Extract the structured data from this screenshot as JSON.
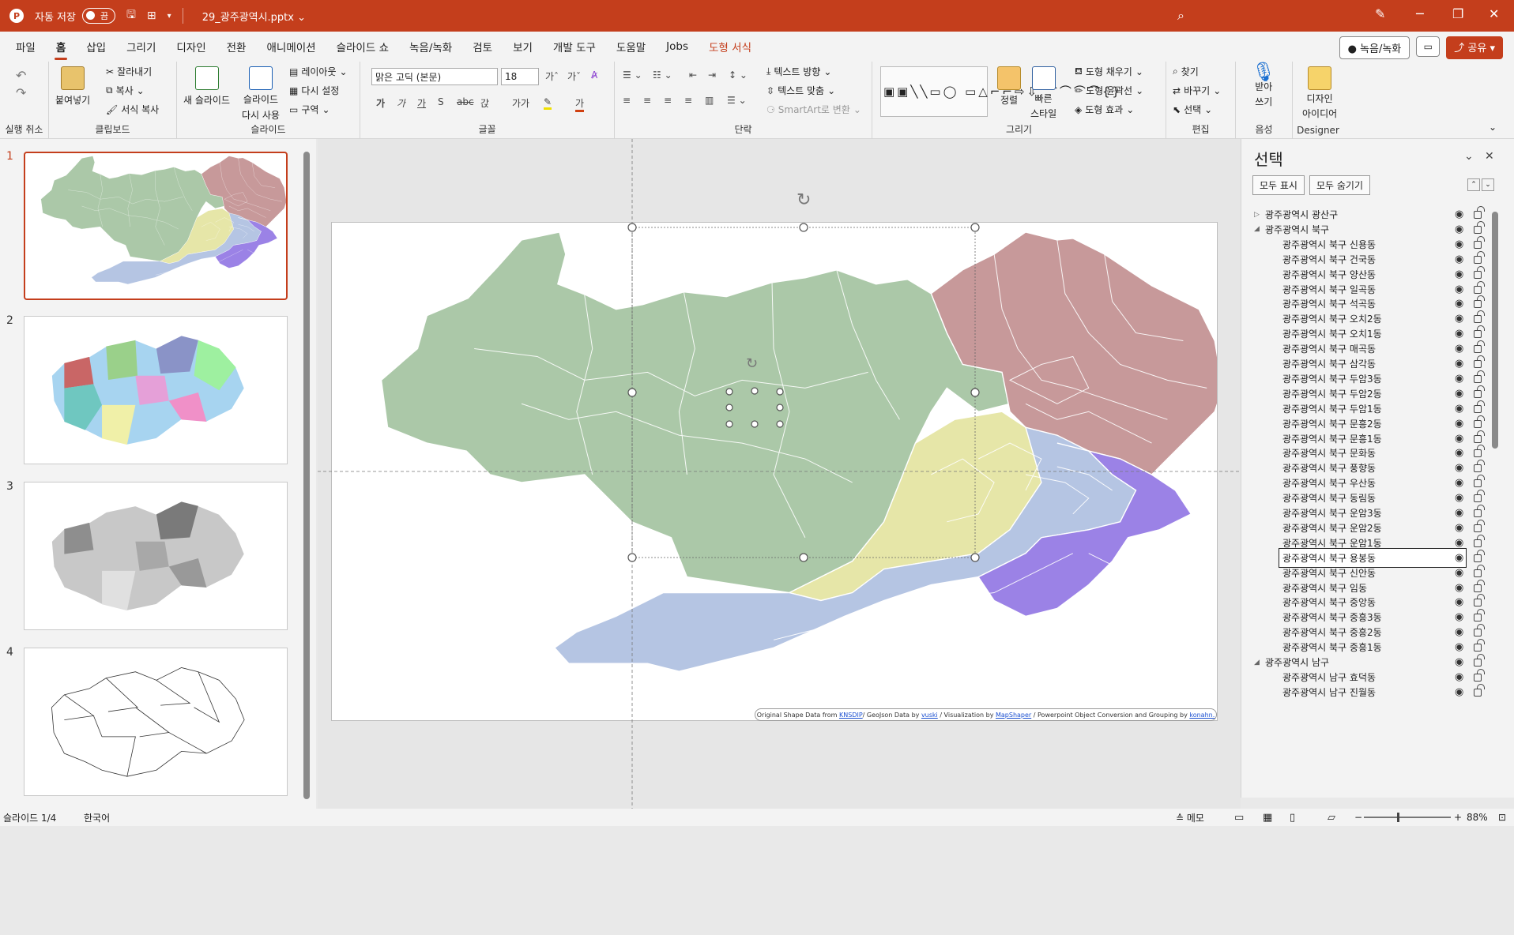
{
  "titlebar": {
    "app_letter": "P",
    "autosave_label": "자동 저장",
    "toggle_state": "끔",
    "filename": "29_광주광역시.pptx ⌄"
  },
  "menu": {
    "tabs": [
      "파일",
      "홈",
      "삽입",
      "그리기",
      "디자인",
      "전환",
      "애니메이션",
      "슬라이드 쇼",
      "녹음/녹화",
      "검토",
      "보기",
      "개발 도구",
      "도움말",
      "Jobs",
      "도형 서식"
    ],
    "active_tab": "홈",
    "record_button": "● 녹음/녹화",
    "share_button": "공유"
  },
  "ribbon": {
    "undo": {
      "label": "실행 취소"
    },
    "clipboard": {
      "label": "클립보드",
      "paste": "붙여넣기",
      "cut": "잘라내기",
      "copy": "복사",
      "format_painter": "서식 복사"
    },
    "slides": {
      "label": "슬라이드",
      "new_slide": "새 슬라이드",
      "reuse_slide_1": "슬라이드",
      "reuse_slide_2": "다시 사용",
      "layout": "레이아웃",
      "reset": "다시 설정",
      "section": "구역"
    },
    "font": {
      "label": "글꼴",
      "font_name": "맑은 고딕 (본문)",
      "font_size": "18"
    },
    "paragraph": {
      "label": "단락",
      "text_direction": "텍스트 방향",
      "align_text": "텍스트 맞춤",
      "smartart": "SmartArt로 변환"
    },
    "drawing": {
      "label": "그리기",
      "arrange": "정렬",
      "quick_styles_1": "빠른",
      "quick_styles_2": "스타일",
      "fill": "도형 채우기",
      "outline": "도형 윤곽선",
      "effects": "도형 효과"
    },
    "editing": {
      "label": "편집",
      "find": "찾기",
      "replace": "바꾸기",
      "select": "선택"
    },
    "voice": {
      "label": "음성",
      "dictate_1": "받아",
      "dictate_2": "쓰기"
    },
    "designer": {
      "label": "Designer",
      "ideas_1": "디자인",
      "ideas_2": "아이디어"
    }
  },
  "slides": [
    {
      "number": "1"
    },
    {
      "number": "2"
    },
    {
      "number": "3"
    },
    {
      "number": "4"
    }
  ],
  "map": {
    "colors": {
      "gwangsan": "#abc8a8",
      "buk": "#c7999a",
      "seo": "#e6e6a8",
      "nam": "#b5c5e3",
      "dong": "#9b82e6"
    }
  },
  "credit": {
    "prefix": "Original Shape Data from",
    "src1": "KNSDIP",
    "mid1": "/ GeoJson Data by",
    "src2": "vuski",
    "mid2": "/ Visualization  by",
    "src3": "MapShaper",
    "mid3": "/ Powerpoint Object Conversion and Grouping  by",
    "src4": "konahn."
  },
  "selection_pane": {
    "title": "선택",
    "show_all": "모두 표시",
    "hide_all": "모두 숨기기",
    "rows": [
      {
        "label": "광주광역시 광산구",
        "level": 0,
        "expanded": false
      },
      {
        "label": "광주광역시 북구",
        "level": 0,
        "expanded": true
      },
      {
        "label": "광주광역시 북구 신용동",
        "level": 1
      },
      {
        "label": "광주광역시 북구 건국동",
        "level": 1
      },
      {
        "label": "광주광역시 북구 양산동",
        "level": 1
      },
      {
        "label": "광주광역시 북구 일곡동",
        "level": 1
      },
      {
        "label": "광주광역시 북구 석곡동",
        "level": 1
      },
      {
        "label": "광주광역시 북구 오치2동",
        "level": 1
      },
      {
        "label": "광주광역시 북구 오치1동",
        "level": 1
      },
      {
        "label": "광주광역시 북구 매곡동",
        "level": 1
      },
      {
        "label": "광주광역시 북구 삼각동",
        "level": 1
      },
      {
        "label": "광주광역시 북구 두암3동",
        "level": 1
      },
      {
        "label": "광주광역시 북구 두암2동",
        "level": 1
      },
      {
        "label": "광주광역시 북구 두암1동",
        "level": 1
      },
      {
        "label": "광주광역시 북구 문흥2동",
        "level": 1
      },
      {
        "label": "광주광역시 북구 문흥1동",
        "level": 1
      },
      {
        "label": "광주광역시 북구 문화동",
        "level": 1
      },
      {
        "label": "광주광역시 북구 풍향동",
        "level": 1
      },
      {
        "label": "광주광역시 북구 우산동",
        "level": 1
      },
      {
        "label": "광주광역시 북구 동림동",
        "level": 1
      },
      {
        "label": "광주광역시 북구 운암3동",
        "level": 1
      },
      {
        "label": "광주광역시 북구 운암2동",
        "level": 1
      },
      {
        "label": "광주광역시 북구 운암1동",
        "level": 1
      },
      {
        "label": "광주광역시 북구 용봉동",
        "level": 1,
        "selected": true
      },
      {
        "label": "광주광역시 북구 신안동",
        "level": 1
      },
      {
        "label": "광주광역시 북구 임동",
        "level": 1
      },
      {
        "label": "광주광역시 북구 중앙동",
        "level": 1
      },
      {
        "label": "광주광역시 북구 중흥3동",
        "level": 1
      },
      {
        "label": "광주광역시 북구 중흥2동",
        "level": 1
      },
      {
        "label": "광주광역시 북구 중흥1동",
        "level": 1
      },
      {
        "label": "광주광역시 남구",
        "level": 0,
        "expanded": true
      },
      {
        "label": "광주광역시 남구 효덕동",
        "level": 1
      },
      {
        "label": "광주광역시 남구 진월동",
        "level": 1
      }
    ]
  },
  "status": {
    "slide_info": "슬라이드 1/4",
    "language": "한국어",
    "notes": "메모",
    "zoom": "88%"
  }
}
